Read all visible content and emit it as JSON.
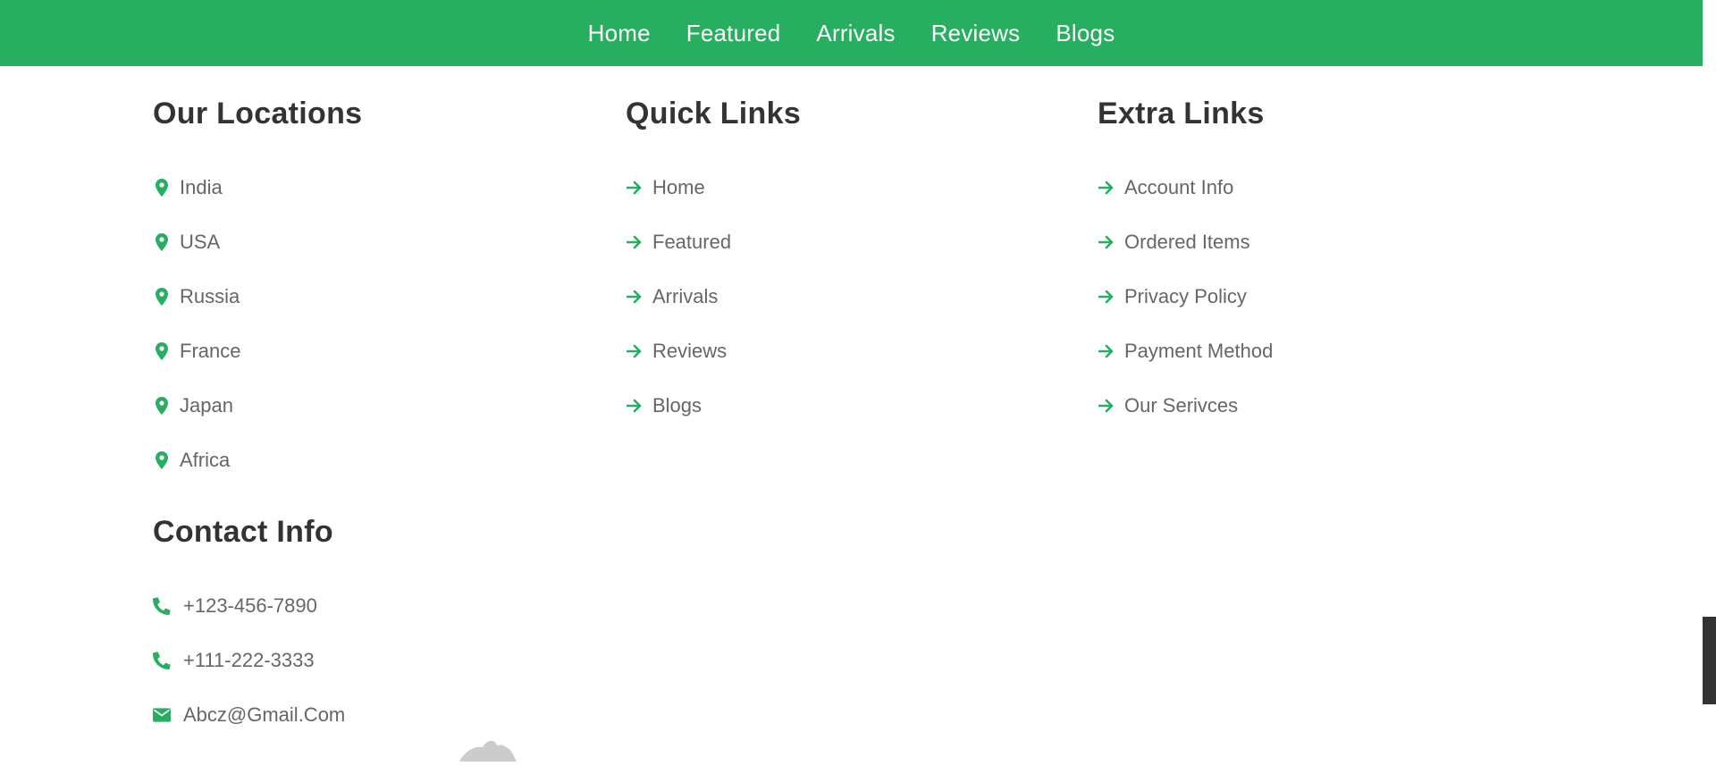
{
  "nav": {
    "items": [
      {
        "label": "Home"
      },
      {
        "label": "Featured"
      },
      {
        "label": "Arrivals"
      },
      {
        "label": "Reviews"
      },
      {
        "label": "Blogs"
      }
    ]
  },
  "locations": {
    "title": "Our Locations",
    "items": [
      {
        "label": "India"
      },
      {
        "label": "USA"
      },
      {
        "label": "Russia"
      },
      {
        "label": "France"
      },
      {
        "label": "Japan"
      },
      {
        "label": "Africa"
      }
    ],
    "icon": "map-marker-icon"
  },
  "quick_links": {
    "title": "Quick Links",
    "items": [
      {
        "label": "Home"
      },
      {
        "label": "Featured"
      },
      {
        "label": "Arrivals"
      },
      {
        "label": "Reviews"
      },
      {
        "label": "Blogs"
      }
    ],
    "icon": "arrow-right-icon"
  },
  "extra_links": {
    "title": "Extra Links",
    "items": [
      {
        "label": "Account Info"
      },
      {
        "label": "Ordered Items"
      },
      {
        "label": "Privacy Policy"
      },
      {
        "label": "Payment Method"
      },
      {
        "label": "Our Serivces"
      }
    ],
    "icon": "arrow-right-icon"
  },
  "contact": {
    "title": "Contact Info",
    "items": [
      {
        "label": "+123-456-7890",
        "icon": "phone-icon"
      },
      {
        "label": "+111-222-3333",
        "icon": "phone-icon"
      },
      {
        "label": "Abcz@Gmail.Com",
        "icon": "envelope-icon"
      }
    ]
  },
  "colors": {
    "accent": "#27ae60",
    "heading": "#333333",
    "text": "#666666"
  }
}
